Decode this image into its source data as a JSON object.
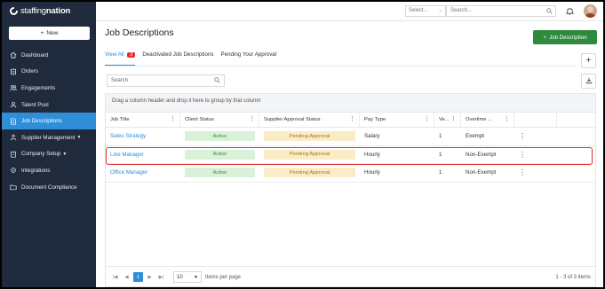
{
  "brand": {
    "name_light": "staffing",
    "name_bold": "nation"
  },
  "sidebar": {
    "new_label": "New",
    "items": [
      {
        "label": "Dashboard",
        "icon": "home-icon"
      },
      {
        "label": "Orders",
        "icon": "orders-icon"
      },
      {
        "label": "Engagements",
        "icon": "people-icon"
      },
      {
        "label": "Talent Pool",
        "icon": "person-icon"
      },
      {
        "label": "Job Descriptions",
        "icon": "document-icon",
        "active": true
      },
      {
        "label": "Supplier Management",
        "icon": "supplier-icon",
        "chevron": true
      },
      {
        "label": "Company Setup",
        "icon": "building-icon",
        "chevron": true
      },
      {
        "label": "Integrations",
        "icon": "integrations-icon"
      },
      {
        "label": "Document Compliance",
        "icon": "folder-icon"
      }
    ]
  },
  "topbar": {
    "select_placeholder": "Select...",
    "search_placeholder": "Search..."
  },
  "page": {
    "title": "Job Descriptions",
    "add_button": "Job Description",
    "tabs": [
      {
        "label": "View All",
        "badge": "3",
        "active": true
      },
      {
        "label": "Deactivated Job Descriptions"
      },
      {
        "label": "Pending Your Approval"
      }
    ]
  },
  "grid": {
    "search_placeholder": "Search",
    "group_hint": "Drag a column header and drop it here to group by that column",
    "columns": [
      "Job Title",
      "Client Status",
      "Supplier Approval Status",
      "Pay Type",
      "Ve...",
      "Overtime ...",
      ""
    ],
    "rows": [
      {
        "title": "Sales Strategy",
        "client_status": "Active",
        "supplier_status": "Pending Approval",
        "pay_type": "Salary",
        "version": "1",
        "overtime": "Exempt"
      },
      {
        "title": "Line Manager",
        "client_status": "Active",
        "supplier_status": "Pending Approval",
        "pay_type": "Hourly",
        "version": "1",
        "overtime": "Non-Exempt"
      },
      {
        "title": "Office Manager",
        "client_status": "Active",
        "supplier_status": "Pending Approval",
        "pay_type": "Hourly",
        "version": "1",
        "overtime": "Non-Exempt"
      }
    ]
  },
  "pager": {
    "current_page": "1",
    "page_size": "10",
    "items_per_page_label": "Items per page",
    "count_label": "1 - 3 of 3 items"
  },
  "colors": {
    "sidebar": "#1f2b3d",
    "accent": "#2e8fd8",
    "add_button": "#2e8a3c",
    "active_pill": "#d9f0d9",
    "pending_pill": "#fbecc8",
    "highlight": "#e03131"
  }
}
